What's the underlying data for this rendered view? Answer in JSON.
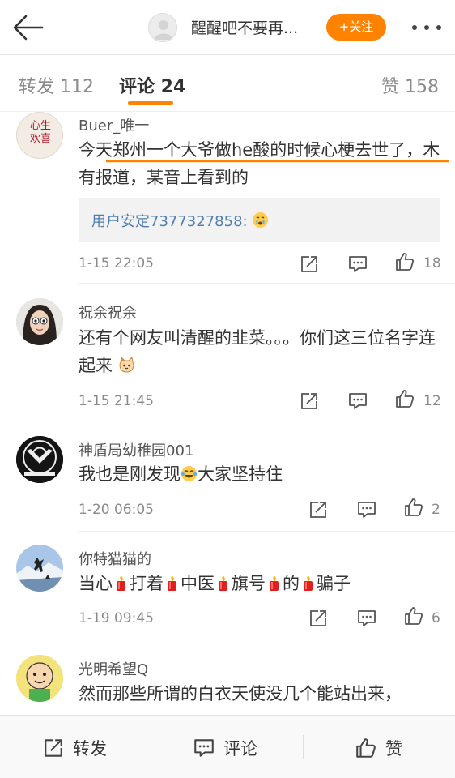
{
  "header": {
    "title": "醒醒吧不要再...",
    "follow_label": "+关注",
    "icons": [
      "back-arrow-icon",
      "more-dots-icon"
    ]
  },
  "tabs": {
    "repost": "转发 112",
    "comment": "评论 24",
    "like": "赞 158"
  },
  "comments": [
    {
      "user": "Buer_唯一",
      "text": "今天郑州一个大爷做he酸的时候心梗去世了，木有报道，某音上看到的",
      "reply": "用户安定7377327858:",
      "time": "1-15 22:05",
      "likes": "18"
    },
    {
      "user": "祝余祝余",
      "text_main": "还有个网友叫清醒的韭菜。。。你们这三位名字连起来",
      "time": "1-15 21:45",
      "likes": "12"
    },
    {
      "user": "神盾局幼稚园001",
      "text_a": "我也是刚发现",
      "text_b": "大家坚持住",
      "time": "1-20 06:05",
      "likes": "2"
    },
    {
      "user": "你特猫猫的",
      "parts": [
        "当心",
        "打着",
        "中医",
        "旗号",
        "的",
        "骗子"
      ],
      "time": "1-19 09:45",
      "likes": "6"
    },
    {
      "user": "光明希望Q",
      "text": "然而那些所谓的白衣天使没几个能站出来，"
    }
  ],
  "avatar_texts": {
    "buer": [
      "心生",
      "欢喜"
    ]
  },
  "bottom": {
    "repost": "转发",
    "comment": "评论",
    "like": "赞"
  },
  "colors": {
    "accent": "#ff8200",
    "link": "#507daf"
  }
}
